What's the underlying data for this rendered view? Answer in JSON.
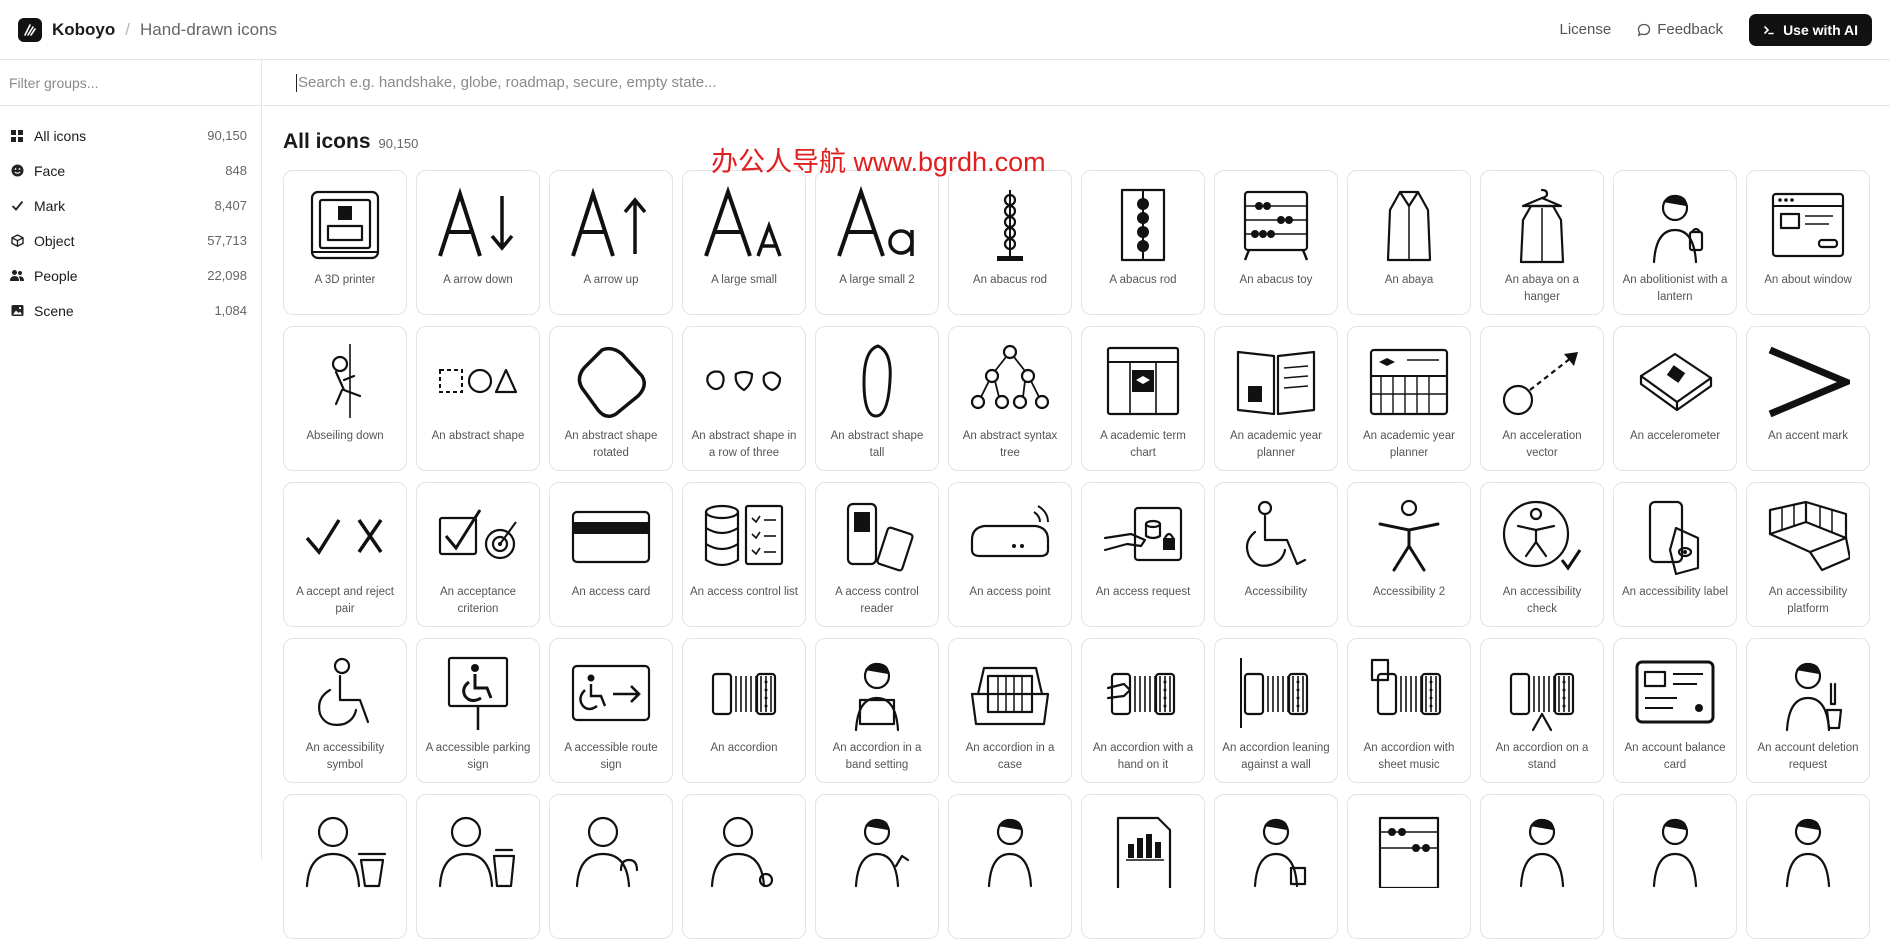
{
  "header": {
    "brand": "Koboyo",
    "separator": "/",
    "page": "Hand-drawn icons",
    "license": "License",
    "feedback": "Feedback",
    "ai_button": "Use with AI"
  },
  "sidebar": {
    "filter_placeholder": "Filter groups...",
    "groups": [
      {
        "label": "All icons",
        "count": "90,150",
        "icon": "grid-icon"
      },
      {
        "label": "Face",
        "count": "848",
        "icon": "face-icon"
      },
      {
        "label": "Mark",
        "count": "8,407",
        "icon": "check-icon"
      },
      {
        "label": "Object",
        "count": "57,713",
        "icon": "cube-icon"
      },
      {
        "label": "People",
        "count": "22,098",
        "icon": "people-icon"
      },
      {
        "label": "Scene",
        "count": "1,084",
        "icon": "image-icon"
      }
    ]
  },
  "main": {
    "search_placeholder": "Search e.g. handshake, globe, roadmap, secure, empty state...",
    "title": "All icons",
    "count": "90,150",
    "watermark": "办公人导航 www.bgrdh.com",
    "icons": [
      {
        "label": "A 3D printer",
        "icon": "printer"
      },
      {
        "label": "A arrow down",
        "icon": "a-down"
      },
      {
        "label": "A arrow up",
        "icon": "a-up"
      },
      {
        "label": "A large small",
        "icon": "aa-large-small"
      },
      {
        "label": "A large small 2",
        "icon": "aa-large-small-2"
      },
      {
        "label": "An abacus rod",
        "icon": "abacus-rod"
      },
      {
        "label": "A abacus rod",
        "icon": "abacus-rod-2"
      },
      {
        "label": "An abacus toy",
        "icon": "abacus-toy"
      },
      {
        "label": "An abaya",
        "icon": "abaya"
      },
      {
        "label": "An abaya on a hanger",
        "icon": "abaya-hanger"
      },
      {
        "label": "An abolitionist with a lantern",
        "icon": "person-lantern"
      },
      {
        "label": "An about window",
        "icon": "window"
      },
      {
        "label": "Abseiling down",
        "icon": "abseil"
      },
      {
        "label": "An abstract shape",
        "icon": "shapes"
      },
      {
        "label": "An abstract shape rotated",
        "icon": "blob"
      },
      {
        "label": "An abstract shape in a row of three",
        "icon": "three-blobs"
      },
      {
        "label": "An abstract shape tall",
        "icon": "tall-blob"
      },
      {
        "label": "An abstract syntax tree",
        "icon": "tree"
      },
      {
        "label": "A academic term chart",
        "icon": "term-chart"
      },
      {
        "label": "An academic year planner",
        "icon": "planner-book"
      },
      {
        "label": "An academic year planner",
        "icon": "planner-board"
      },
      {
        "label": "An acceleration vector",
        "icon": "vector"
      },
      {
        "label": "An accelerometer",
        "icon": "chip"
      },
      {
        "label": "An accent mark",
        "icon": "accent"
      },
      {
        "label": "A accept and reject pair",
        "icon": "check-x"
      },
      {
        "label": "An acceptance criterion",
        "icon": "checkbox-target"
      },
      {
        "label": "An access card",
        "icon": "card"
      },
      {
        "label": "An access control list",
        "icon": "db-list"
      },
      {
        "label": "A access control reader",
        "icon": "reader"
      },
      {
        "label": "An access point",
        "icon": "router"
      },
      {
        "label": "An access request",
        "icon": "hand-lock"
      },
      {
        "label": "Accessibility",
        "icon": "wheelchair"
      },
      {
        "label": "Accessibility 2",
        "icon": "figure"
      },
      {
        "label": "An accessibility check",
        "icon": "figure-check"
      },
      {
        "label": "An accessibility label",
        "icon": "phone-tag"
      },
      {
        "label": "An accessibility platform",
        "icon": "platform"
      },
      {
        "label": "An accessibility symbol",
        "icon": "wheelchair-2"
      },
      {
        "label": "A accessible parking sign",
        "icon": "parking-sign"
      },
      {
        "label": "A accessible route sign",
        "icon": "route-sign"
      },
      {
        "label": "An accordion",
        "icon": "accordion"
      },
      {
        "label": "An accordion in a band setting",
        "icon": "accordion-player"
      },
      {
        "label": "An accordion in a case",
        "icon": "accordion-case"
      },
      {
        "label": "An accordion with a hand on it",
        "icon": "accordion-hand"
      },
      {
        "label": "An accordion leaning against a wall",
        "icon": "accordion-wall"
      },
      {
        "label": "An accordion with sheet music",
        "icon": "accordion-music"
      },
      {
        "label": "An accordion on a stand",
        "icon": "accordion-stand"
      },
      {
        "label": "An account balance card",
        "icon": "balance-card"
      },
      {
        "label": "An account deletion request",
        "icon": "person-trash"
      },
      {
        "label": "",
        "icon": "user-trash"
      },
      {
        "label": "",
        "icon": "user-trash-2"
      },
      {
        "label": "",
        "icon": "user-lock"
      },
      {
        "label": "",
        "icon": "user-plain"
      },
      {
        "label": "",
        "icon": "person-hand"
      },
      {
        "label": "",
        "icon": "person-boy"
      },
      {
        "label": "",
        "icon": "chart-doc"
      },
      {
        "label": "",
        "icon": "person-calc"
      },
      {
        "label": "",
        "icon": "abacus"
      },
      {
        "label": "",
        "icon": "person-2"
      },
      {
        "label": "",
        "icon": "person-3"
      },
      {
        "label": "",
        "icon": "person-4"
      }
    ]
  }
}
